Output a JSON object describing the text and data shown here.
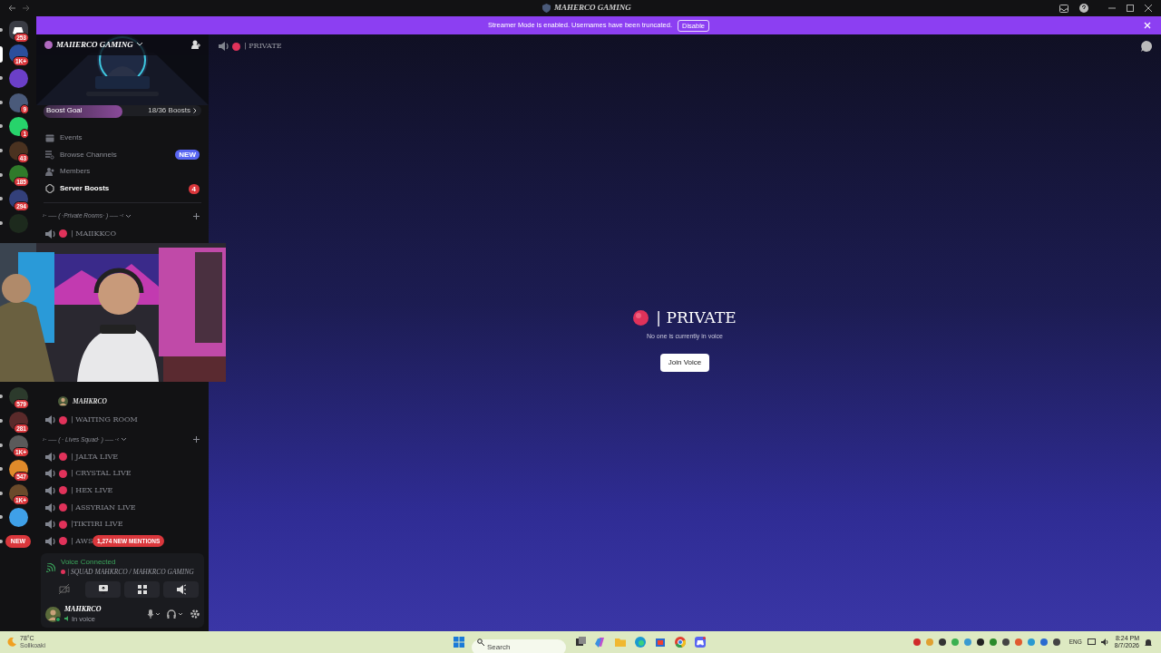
{
  "window": {
    "title": "MAHERCO GAMING"
  },
  "banner": {
    "text": "Streamer Mode is enabled. Usernames have been truncated.",
    "button": "Disable"
  },
  "servers_top": [
    {
      "kind": "home",
      "badge": "253",
      "color": "#3a3c44",
      "selected": false
    },
    {
      "kind": "server",
      "badge": "1K+",
      "color": "#2b4f9c",
      "selected": true
    },
    {
      "kind": "server",
      "color": "#6b3fc8",
      "selected": false
    },
    {
      "kind": "server",
      "badge": "9",
      "color": "#4a5a7a",
      "selected": false
    },
    {
      "kind": "server",
      "badge": "1",
      "color": "#27d36b",
      "selected": false
    },
    {
      "kind": "server",
      "badge": "43",
      "color": "#4a3220",
      "selected": false
    },
    {
      "kind": "server",
      "badge": "185",
      "color": "#2f7a2a",
      "selected": false
    },
    {
      "kind": "server",
      "badge": "294",
      "color": "#33407a",
      "selected": false
    },
    {
      "kind": "server",
      "color": "#1d2a1d",
      "selected": false
    }
  ],
  "servers_bottom": [
    {
      "kind": "server",
      "badge": "579",
      "color": "#2c3a2c",
      "selected": false
    },
    {
      "kind": "server",
      "badge": "281",
      "color": "#5a2a2a",
      "selected": false
    },
    {
      "kind": "server",
      "badge": "1K+",
      "color": "#5a5a5a",
      "selected": false
    },
    {
      "kind": "server",
      "badge": "547",
      "color": "#e08a2a",
      "selected": false
    },
    {
      "kind": "server",
      "badge": "1K+",
      "color": "#6a4a2a",
      "selected": false
    },
    {
      "kind": "server",
      "color": "#3fa0e8",
      "selected": false
    },
    {
      "kind": "new",
      "badge": "NEW",
      "selected": false
    }
  ],
  "guild": {
    "name": "MAIIERCO GAMING",
    "boost": {
      "label": "Boost Goal",
      "progress": "18/36 Boosts",
      "level": 0.5
    }
  },
  "menu": [
    {
      "kind": "events",
      "label": "Events",
      "unread": false
    },
    {
      "kind": "browse",
      "label": "Browse Channels",
      "badge": "NEW",
      "unread": false
    },
    {
      "kind": "members",
      "label": "Members",
      "unread": false
    },
    {
      "kind": "boosts",
      "label": "Server Boosts",
      "badge": "4",
      "unread": true
    }
  ],
  "channels_top": [
    {
      "kind": "category",
      "label": "›· ── ( ·Private Rooms· ) ── ·‹"
    },
    {
      "kind": "voice",
      "label": "| MAIIKKCO"
    }
  ],
  "channels_bottom": [
    {
      "kind": "member",
      "label": "MAHKRCO"
    },
    {
      "kind": "voice",
      "label": "| WAITING ROOM"
    },
    {
      "kind": "category",
      "label": "›· ── ( · Lives Squad· ) ── ·‹"
    },
    {
      "kind": "voice",
      "label": "| JALTA LIVE"
    },
    {
      "kind": "voice",
      "label": "| CRYSTAL LIVE"
    },
    {
      "kind": "voice",
      "label": "| HEX LIVE"
    },
    {
      "kind": "voice",
      "label": "| ASSYRIAN LIVE"
    },
    {
      "kind": "voice",
      "label": "|TIKTIRI LIVE"
    },
    {
      "kind": "voice",
      "label": "| AWS"
    }
  ],
  "mentions": "1,274 NEW MENTIONS",
  "voice": {
    "status": "Voice Connected",
    "channel": "| SQUAD MAHKRCO / MAHKRCO GAMING"
  },
  "user": {
    "name": "MAHKRCO",
    "status": "In voice"
  },
  "main": {
    "header": "| PRIVATE",
    "title": "| PRIVATE",
    "subtitle": "No one is currently in voice",
    "button": "Join Voice"
  },
  "taskbar": {
    "temp": "78°C",
    "place": "Sollkoaki",
    "search": {
      "placeholder": "Search"
    },
    "language": "ENG",
    "time": "8:24 PM",
    "date": "8/7/2026"
  }
}
